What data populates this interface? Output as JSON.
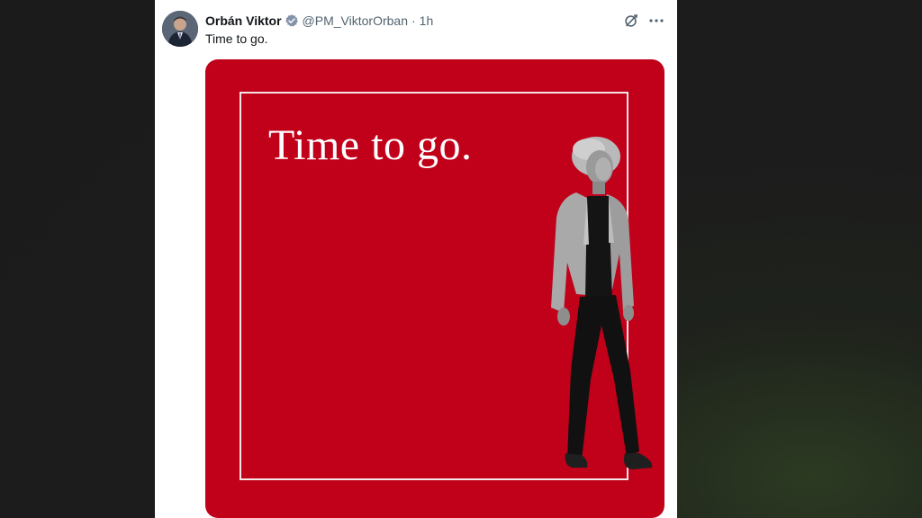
{
  "author": {
    "display_name": "Orbán Viktor",
    "handle": "@PM_ViktorOrban",
    "separator": "·",
    "timestamp": "1h"
  },
  "icons": {
    "verified": "verified-badge-icon",
    "grok": "grok-icon",
    "more": "more-options-icon"
  },
  "tweet": {
    "text": "Time to go."
  },
  "media": {
    "headline": "Time to go.",
    "background_color": "#c1001a"
  }
}
